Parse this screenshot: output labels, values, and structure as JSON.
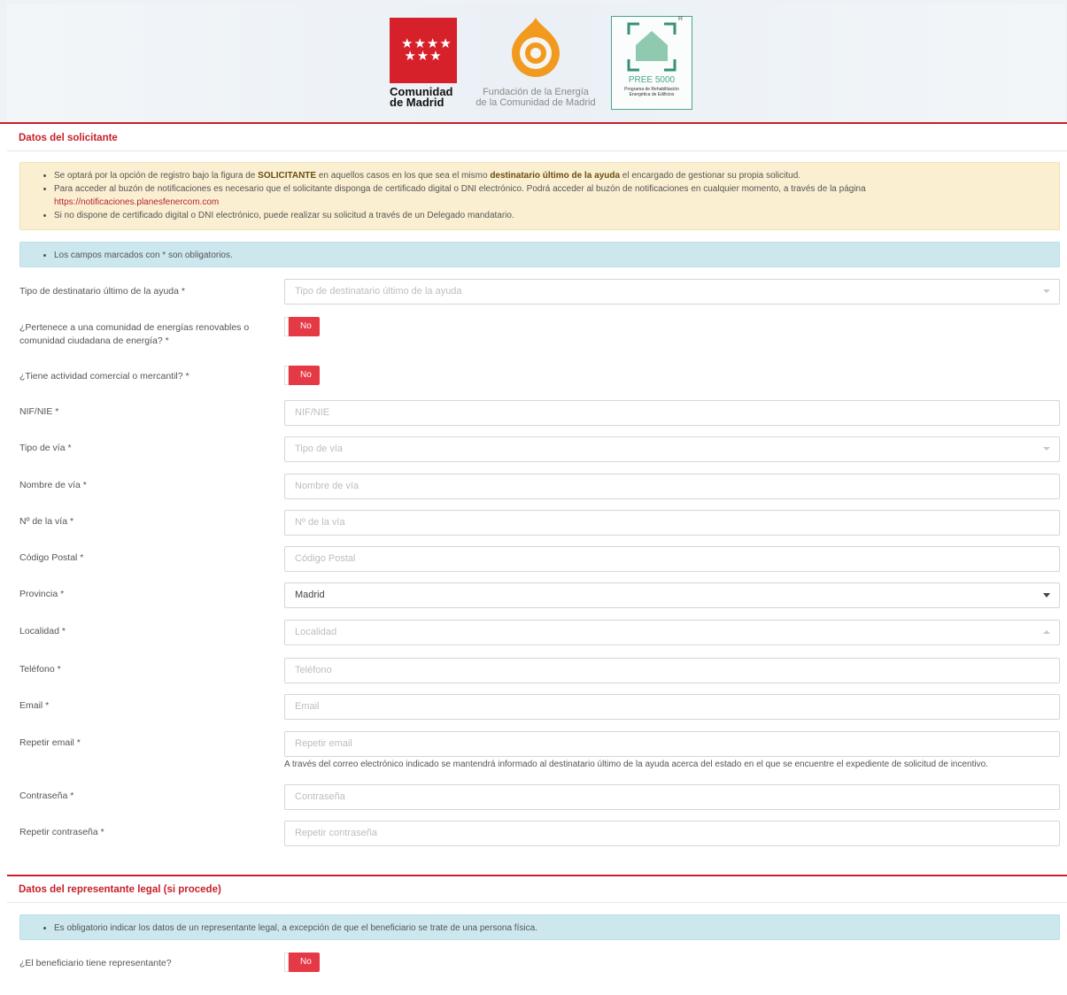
{
  "header": {
    "cm_logo_line1": "Comunidad",
    "cm_logo_line2": "de Madrid",
    "cm_stars": "★★★★ ★★★",
    "fe_logo_line1": "Fundación de la Energía",
    "fe_logo_line2": "de la Comunidad de Madrid",
    "pree_title": "PREE 5000",
    "pree_sub1": "Programa de Rehabilitación",
    "pree_sub2": "Energética de Edificios",
    "pree_r": "R"
  },
  "solicitante": {
    "title": "Datos del solicitante",
    "warning": {
      "item1_pre": "Se optará por la opción de registro bajo la figura de ",
      "item1_b1": "SOLICITANTE",
      "item1_mid": " en aquellos casos en los que sea el mismo ",
      "item1_b2": "destinatario último de la ayuda",
      "item1_post": " el encargado de gestionar su propia solicitud.",
      "item2": "Para acceder al buzón de notificaciones es necesario que el solicitante disponga de certificado digital o DNI electrónico. Podrá acceder al buzón de notificaciones en cualquier momento, a través de la página",
      "item2_link": "https://notificaciones.planesfenercom.com",
      "item3": "Si no dispone de certificado digital o DNI electrónico, puede realizar su solicitud a través de un Delegado mandatario."
    },
    "info": "Los campos marcados con * son obligatorios.",
    "fields": {
      "tipo_dest_label": "Tipo de destinatario último de la ayuda *",
      "tipo_dest_placeholder": "Tipo de destinatario último de la ayuda",
      "comunidad_label_1": "¿Pertenece a una comunidad de energías renovables o",
      "comunidad_label_2": "comunidad ciudadana de energía? *",
      "comunidad_value": "No",
      "actividad_label": "¿Tiene actividad comercial o mercantil? *",
      "actividad_value": "No",
      "nif_label": "NIF/NIE *",
      "nif_placeholder": "NIF/NIE",
      "tipo_via_label": "Tipo de vía *",
      "tipo_via_placeholder": "Tipo de vía",
      "nombre_via_label": "Nombre de vía *",
      "nombre_via_placeholder": "Nombre de vía",
      "num_via_label": "Nº de la vía *",
      "num_via_placeholder": "Nº de la vía",
      "cp_label": "Código Postal *",
      "cp_placeholder": "Código Postal",
      "provincia_label": "Provincia *",
      "provincia_value": "Madrid",
      "localidad_label": "Localidad *",
      "localidad_placeholder": "Localidad",
      "telefono_label": "Teléfono *",
      "telefono_placeholder": "Teléfono",
      "email_label": "Email *",
      "email_placeholder": "Email",
      "rep_email_label": "Repetir email *",
      "rep_email_placeholder": "Repetir email",
      "email_help": "A través del correo electrónico indicado se mantendrá informado al destinatario último de la ayuda acerca del estado en el que se encuentre el expediente de solicitud de incentivo.",
      "pass_label": "Contraseña *",
      "pass_placeholder": "Contraseña",
      "rep_pass_label": "Repetir contraseña *",
      "rep_pass_placeholder": "Repetir contraseña"
    }
  },
  "representante": {
    "title": "Datos del representante legal (si procede)",
    "info": "Es obligatorio indicar los datos de un representante legal, a excepción de que el beneficiario se trate de una persona física.",
    "tiene_label": "¿El beneficiario tiene representante?",
    "tiene_value": "No"
  },
  "colors": {
    "accent": "#c9202a",
    "toggle_off": "#e63946",
    "warning_bg": "#fbefd2",
    "info_bg": "#cce8ee"
  }
}
